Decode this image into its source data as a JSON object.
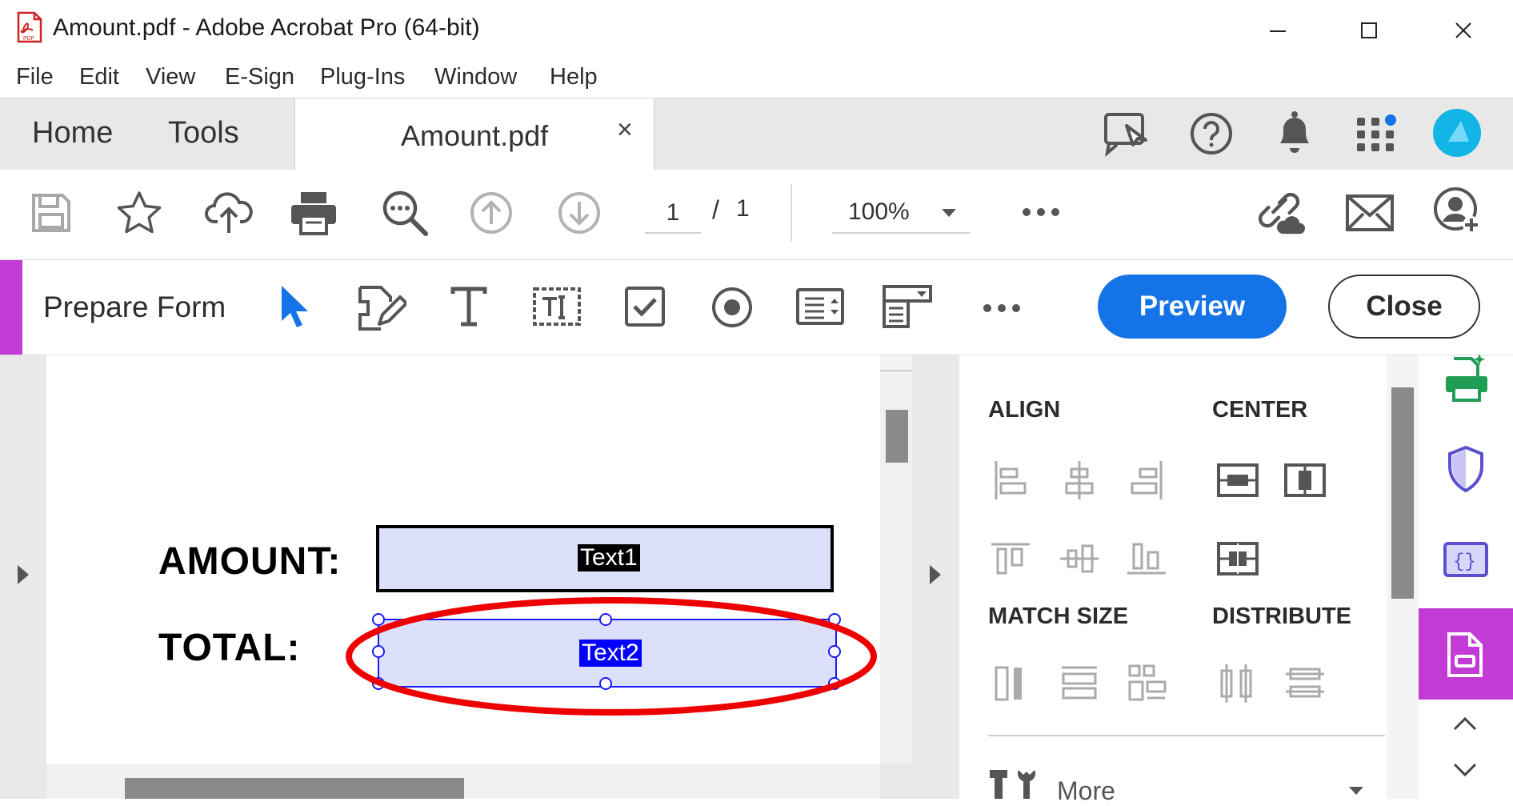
{
  "window": {
    "title": "Amount.pdf - Adobe Acrobat Pro (64-bit)",
    "app_icon": "pdf-file-icon"
  },
  "menu": [
    "File",
    "Edit",
    "View",
    "E-Sign",
    "Plug-Ins",
    "Window",
    "Help"
  ],
  "tabs": {
    "home": "Home",
    "tools": "Tools",
    "document": "Amount.pdf",
    "close_glyph": "×"
  },
  "toolbar": {
    "page_current": "1",
    "page_sep": "/",
    "page_total": "1",
    "zoom": "100%"
  },
  "form_bar": {
    "title": "Prepare Form",
    "preview_label": "Preview",
    "close_label": "Close",
    "accent_color": "#c23bd4"
  },
  "document": {
    "amount_label": "AMOUNT:",
    "total_label": "TOTAL:",
    "field1": "Text1",
    "field2": "Text2"
  },
  "panel": {
    "align": "ALIGN",
    "center": "CENTER",
    "match_size": "MATCH SIZE",
    "distribute": "DISTRIBUTE",
    "more": "More"
  },
  "colors": {
    "primary_blue": "#1473e6",
    "annotation_red": "#ee0000",
    "field_fill": "#dde0fb",
    "selection_blue": "#1a1aff"
  }
}
